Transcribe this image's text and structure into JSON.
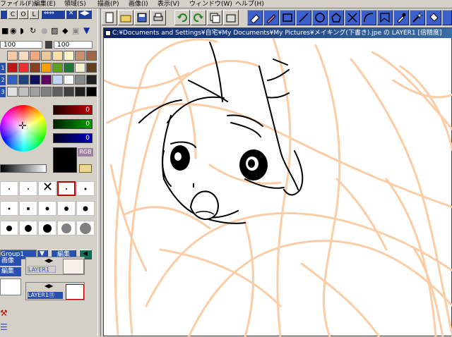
{
  "menu": [
    "ファイル(F)",
    "編集(E)",
    "領域(S)",
    "描画(P)",
    "画像(I)",
    "表示(V)",
    "ウィンドウ(W)",
    "ヘルプ(H)"
  ],
  "left_panel": {
    "mode_buttons": [
      "C",
      "O",
      "L"
    ],
    "slider_values": [
      "100",
      "100"
    ],
    "palette_rows": [
      "1",
      "2",
      "3"
    ],
    "palette_colors": [
      [
        "#f4c8a0",
        "#f8dcc0",
        "#f0a880",
        "#e8c898",
        "#f8e0a8",
        "#fff4c8",
        "#c89070",
        "#a06848"
      ],
      [
        "#c01818",
        "#f03030",
        "#884020",
        "#f8a000",
        "#60a020",
        "#207838",
        "#f0f0d0",
        "#604020"
      ],
      [
        "#3060c0",
        "#204080",
        "#101060",
        "#600060",
        "#c0d8f8",
        "#f8f8f8",
        "#888888",
        "#202020"
      ],
      [
        "#e0e0e0",
        "#c0c0c0",
        "#a0a0a0",
        "#808080",
        "#606060",
        "#404040",
        "#202020",
        "#000000"
      ]
    ],
    "rgb_values": [
      "0",
      "0",
      "0"
    ],
    "rgb_label": "RGB",
    "layer_group": "Group1",
    "edit_label": "編集",
    "image_label": "画像",
    "edit_label2": "編集",
    "layers": [
      "LAYER1",
      "LAYER1⑪"
    ]
  },
  "canvas": {
    "title": "C:¥Documents and Settings¥自宅¥My Documents¥My Pictures¥メイキング(下書き).jpe の LAYER1 [倍精度]",
    "sketch_color": "#fbcda6",
    "line_color": "#000000"
  }
}
